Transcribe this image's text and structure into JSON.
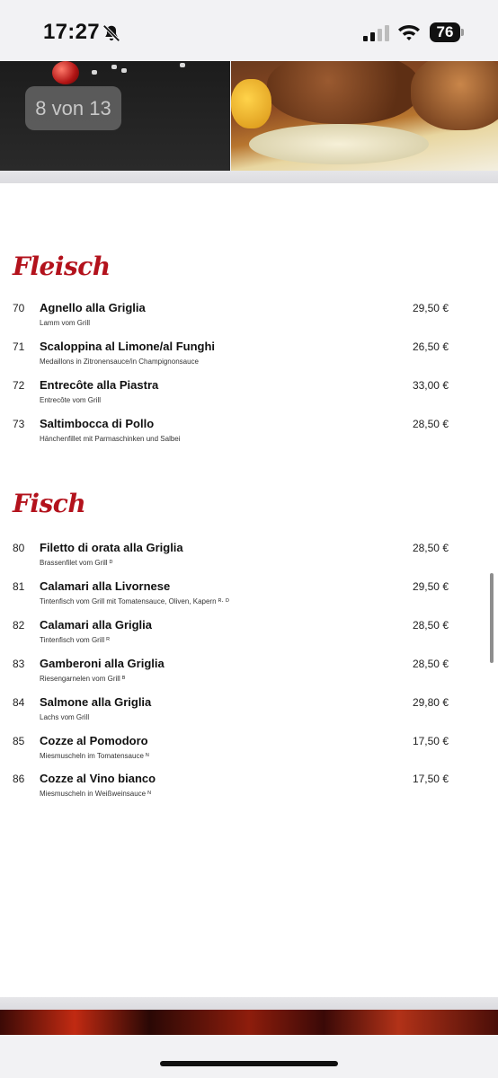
{
  "status_bar": {
    "time": "17:27",
    "battery": "76",
    "icons": [
      "bell-slash-icon",
      "cellular-signal-icon",
      "wifi-icon",
      "battery-icon"
    ]
  },
  "gallery": {
    "counter": "8 von 13"
  },
  "sections": [
    {
      "title": "Fleisch",
      "items": [
        {
          "num": "70",
          "name": "Agnello alla Griglia",
          "desc": "Lamm vom Grill",
          "price": "29,50 €"
        },
        {
          "num": "71",
          "name": "Scaloppina al Limone/al Funghi",
          "desc": "Medaillons in Zitronensauce/in Champignonsauce",
          "price": "26,50 €"
        },
        {
          "num": "72",
          "name": "Entrecôte alla Piastra",
          "desc": "Entrecôte vom Grill",
          "price": "33,00 €"
        },
        {
          "num": "73",
          "name": "Saltimbocca di Pollo",
          "desc": "Hänchenfillet mit Parmaschinken und Salbei",
          "price": "28,50 €"
        }
      ]
    },
    {
      "title": "Fisch",
      "items": [
        {
          "num": "80",
          "name": "Filetto di orata alla Griglia",
          "desc": "Brassenfilet vom Grill ᴰ",
          "price": "28,50 €"
        },
        {
          "num": "81",
          "name": "Calamari alla Livornese",
          "desc": "Tintenfisch vom Grill mit Tomatensauce, Oliven, Kapern ᴿ· ᴰ",
          "price": "29,50 €"
        },
        {
          "num": "82",
          "name": "Calamari alla Griglia",
          "desc": "Tintenfisch vom Grill ᴿ",
          "price": "28,50 €"
        },
        {
          "num": "83",
          "name": "Gamberoni alla Griglia",
          "desc": "Riesengarnelen vom Grill ᴮ",
          "price": "28,50 €"
        },
        {
          "num": "84",
          "name": "Salmone alla Griglia",
          "desc": "Lachs vom Grill",
          "price": "29,80 €"
        },
        {
          "num": "85",
          "name": "Cozze al Pomodoro",
          "desc": "Miesmuscheln im Tomatensauce ᴺ",
          "price": "17,50 €"
        },
        {
          "num": "86",
          "name": "Cozze al Vino bianco",
          "desc": "Miesmuscheln in Weißweinsauce ᴺ",
          "price": "17,50 €"
        }
      ]
    }
  ],
  "colors": {
    "section_title": "#b3121c",
    "background": "#ffffff",
    "chrome": "#f2f2f4"
  }
}
